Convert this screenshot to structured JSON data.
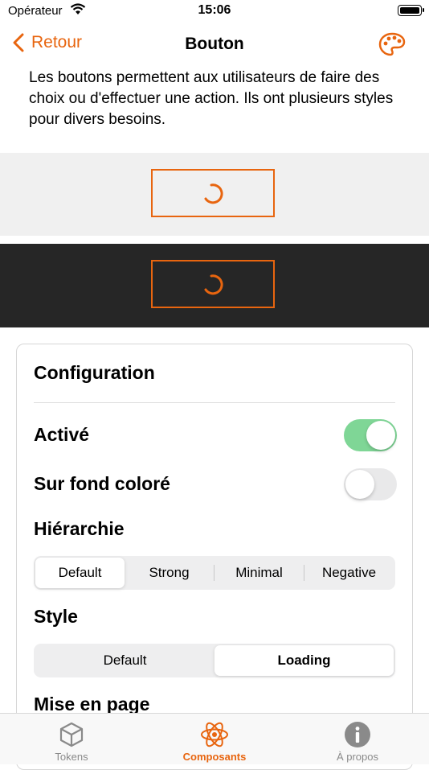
{
  "status": {
    "carrier": "Opérateur",
    "time": "15:06"
  },
  "nav": {
    "back_label": "Retour",
    "title": "Bouton",
    "palette_icon": "palette-icon"
  },
  "description": "Les boutons permettent aux utilisateurs de faire des choix ou d'effectuer une action. Ils ont plusieurs styles pour divers besoins.",
  "colors": {
    "accent": "#e8650f",
    "toggle_on": "#7fd696",
    "dark_bg": "#262626",
    "light_bg": "#f0f0f0"
  },
  "config": {
    "title": "Configuration",
    "enabled": {
      "label": "Activé",
      "on": true
    },
    "on_colored": {
      "label": "Sur fond coloré",
      "on": false
    },
    "hierarchy": {
      "label": "Hiérarchie",
      "options": [
        "Default",
        "Strong",
        "Minimal",
        "Negative"
      ],
      "selected": "Default"
    },
    "style": {
      "label": "Style",
      "options": [
        "Default",
        "Loading"
      ],
      "selected": "Loading"
    },
    "layout": {
      "label": "Mise en page"
    }
  },
  "tabs": [
    {
      "label": "Tokens",
      "icon": "cube-icon",
      "active": false
    },
    {
      "label": "Composants",
      "icon": "atom-icon",
      "active": true
    },
    {
      "label": "À propos",
      "icon": "info-icon",
      "active": false
    }
  ]
}
